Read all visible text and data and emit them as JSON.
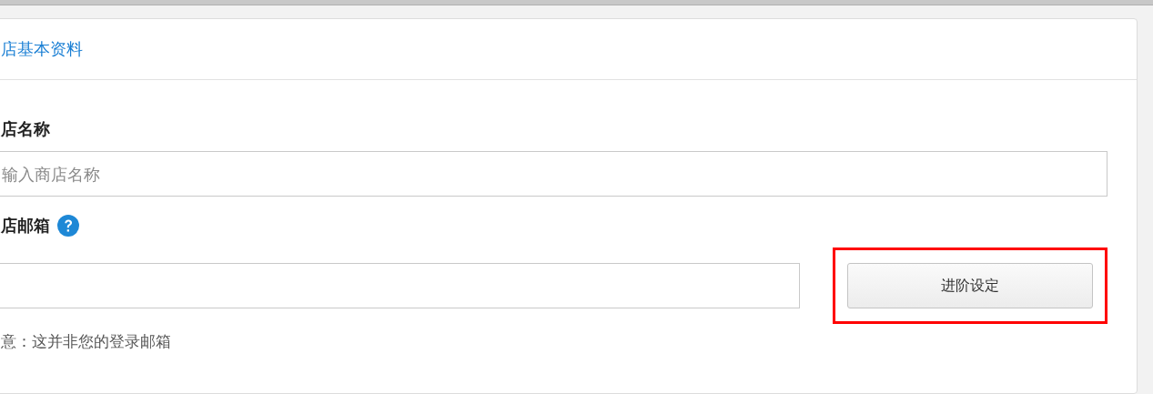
{
  "card": {
    "title": "店基本资料"
  },
  "fields": [
    {
      "label": "店名称",
      "placeholder": "输入商店名称",
      "help": false
    },
    {
      "label": "店邮箱",
      "help": true,
      "note": "意：这并非您的登录邮箱",
      "button": {
        "label": "进阶设定",
        "highlighted": true
      }
    }
  ]
}
